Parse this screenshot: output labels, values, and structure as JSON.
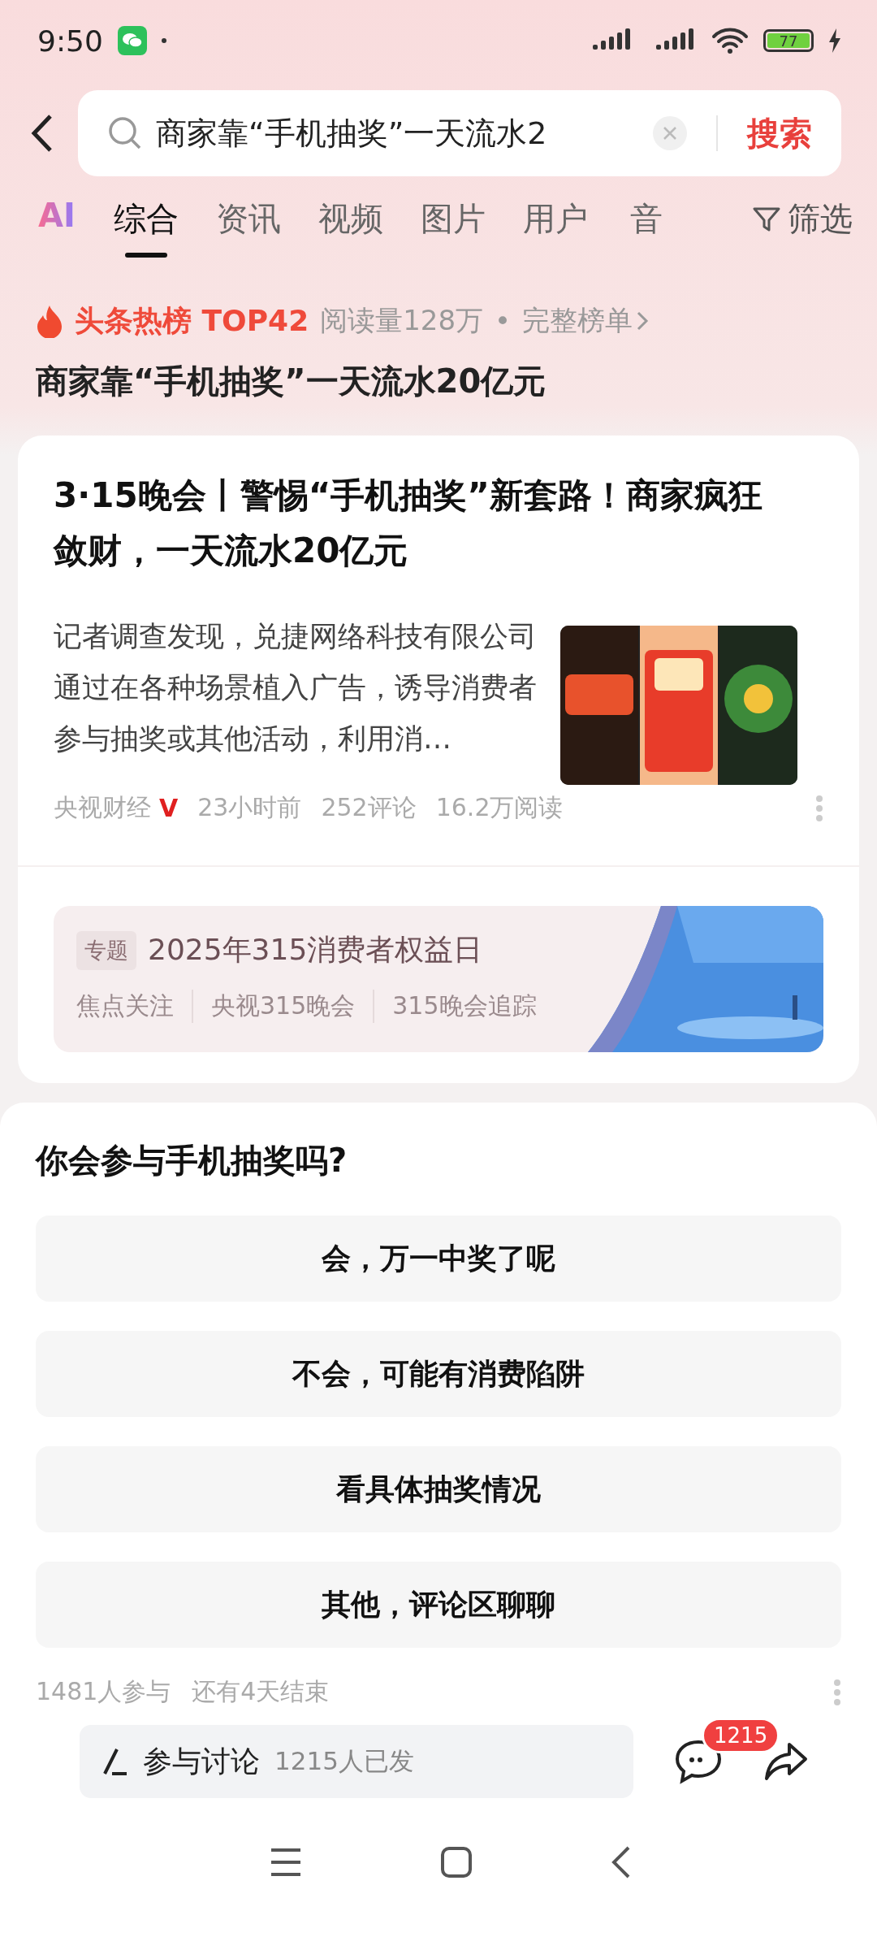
{
  "status_bar": {
    "time": "9:50",
    "battery": "77"
  },
  "search": {
    "value": "商家靠“手机抽奖”一天流水2",
    "button": "搜索"
  },
  "tabs": [
    {
      "label": "AI",
      "kind": "ai",
      "selected": false
    },
    {
      "label": "综合",
      "kind": "text",
      "selected": true
    },
    {
      "label": "资讯",
      "kind": "text",
      "selected": false
    },
    {
      "label": "视频",
      "kind": "text",
      "selected": false
    },
    {
      "label": "图片",
      "kind": "text",
      "selected": false
    },
    {
      "label": "用户",
      "kind": "text",
      "selected": false
    },
    {
      "label": "音",
      "kind": "text",
      "selected": false
    }
  ],
  "filter": "筛选",
  "hot": {
    "badge": "头条热榜 TOP42",
    "reads": "阅读量128万",
    "separator": "•",
    "link": "完整榜单"
  },
  "headline": "商家靠“手机抽奖”一天流水20亿元",
  "article": {
    "title": "3·15晚会丨警惕“手机抽奖”新套路！商家疯狂敛财，一天流水20亿元",
    "summary": "记者调查发现，兑捷网络科技有限公司通过在各种场景植入广告，诱导消费者参与抽奖或其他活动，利用消…",
    "source": "央视财经",
    "verified": "V",
    "time": "23小时前",
    "comments": "252评论",
    "reads": "16.2万阅读"
  },
  "topic": {
    "tag": "专题",
    "title": "2025年315消费者权益日",
    "links": [
      "焦点关注",
      "央视315晚会",
      "315晚会追踪"
    ]
  },
  "poll": {
    "question": "你会参与手机抽奖吗?",
    "options": [
      {
        "label": "会，万一中奖了呢"
      },
      {
        "label": "不会，可能有消费陷阱"
      },
      {
        "label": "看具体抽奖情况"
      },
      {
        "label": "其他，评论区聊聊"
      }
    ],
    "participants": "1481人参与",
    "remaining": "还有4天结束"
  },
  "bottom_bar": {
    "discuss": "参与讨论",
    "count": "1215人已发",
    "comment_badge": "1215"
  }
}
